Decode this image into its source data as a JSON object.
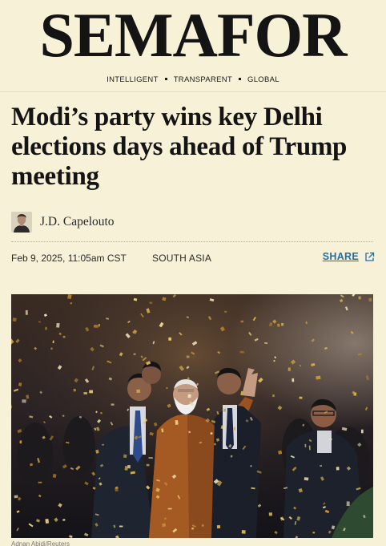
{
  "masthead": {
    "logo": "SEMAFOR",
    "tagline": [
      "INTELLIGENT",
      "TRANSPARENT",
      "GLOBAL"
    ]
  },
  "article": {
    "headline": "Modi’s party wins key Delhi elections days ahead of Trump meeting",
    "author": "J.D. Capelouto",
    "date": "Feb 9, 2025, 11:05am CST",
    "section": "SOUTH ASIA",
    "share_label": "SHARE",
    "photo_credit": "Adnan Abidi/Reuters"
  },
  "icons": {
    "share": "external-link-icon",
    "avatar": "author-avatar"
  },
  "colors": {
    "background": "#f7f1d7",
    "link": "#1f6fa8",
    "text": "#141414"
  }
}
